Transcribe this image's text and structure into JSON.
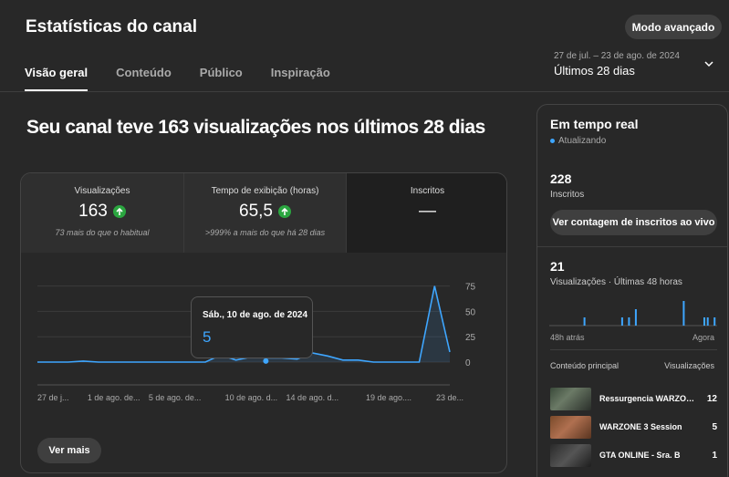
{
  "header": {
    "title": "Estatísticas do canal",
    "advanced_label": "Modo avançado",
    "tabs": [
      {
        "label": "Visão geral",
        "active": true
      },
      {
        "label": "Conteúdo",
        "active": false
      },
      {
        "label": "Público",
        "active": false
      },
      {
        "label": "Inspiração",
        "active": false
      }
    ],
    "date_range": {
      "range": "27 de jul. – 23 de ago. de 2024",
      "label": "Últimos 28 dias"
    }
  },
  "main": {
    "headline": "Seu canal teve 163 visualizações nos últimos 28 dias",
    "metrics": [
      {
        "label": "Visualizações",
        "value": "163",
        "trend": "up",
        "note": "73 mais do que o habitual"
      },
      {
        "label": "Tempo de exibição (horas)",
        "value": "65,5",
        "trend": "up",
        "note": ">999% a mais do que há 28 dias"
      },
      {
        "label": "Inscritos",
        "value": "—",
        "trend": "",
        "note": ""
      }
    ],
    "tooltip": {
      "date": "Sáb., 10 de ago. de 2024",
      "value": "5"
    },
    "more_label": "Ver mais"
  },
  "chart_data": {
    "type": "line",
    "x": [
      "27 de jul.",
      "28 de jul.",
      "29 de jul.",
      "30 de jul.",
      "31 de jul.",
      "1 de ago.",
      "2 de ago.",
      "3 de ago.",
      "4 de ago.",
      "5 de ago.",
      "6 de ago.",
      "7 de ago.",
      "8 de ago.",
      "9 de ago.",
      "10 de ago.",
      "11 de ago.",
      "12 de ago.",
      "13 de ago.",
      "14 de ago.",
      "15 de ago.",
      "16 de ago.",
      "17 de ago.",
      "18 de ago.",
      "19 de ago.",
      "20 de ago.",
      "21 de ago.",
      "22 de ago.",
      "23 de ago."
    ],
    "values": [
      0,
      0,
      0,
      1,
      0,
      0,
      0,
      0,
      0,
      0,
      0,
      0,
      7,
      2,
      5,
      4,
      4,
      3,
      9,
      6,
      2,
      2,
      0,
      0,
      0,
      0,
      75,
      10
    ],
    "tick_labels": [
      "27 de j...",
      "1 de ago. de...",
      "5 de ago. de...",
      "10 de ago. d...",
      "14 de ago. d...",
      "19 de ago....",
      "23 de..."
    ],
    "tick_indices": [
      0,
      5,
      9,
      14,
      18,
      23,
      27
    ],
    "y_ticks": [
      0,
      25,
      50,
      75
    ],
    "ylim": [
      0,
      80
    ],
    "line_color": "#3ea6ff",
    "highlight_index": 14
  },
  "realtime": {
    "title": "Em tempo real",
    "status": "Atualizando",
    "subs_value": "228",
    "subs_label": "Inscritos",
    "live_button": "Ver contagem de inscritos ao vivo",
    "views_value": "21",
    "views_label": "Visualizações · Últimas 48 horas",
    "bars": [
      0,
      0,
      0,
      0,
      0,
      0,
      0,
      0,
      0,
      0,
      1,
      0,
      0,
      0,
      0,
      0,
      0,
      0,
      0,
      0,
      0,
      1,
      0,
      1,
      0,
      2,
      0,
      0,
      0,
      0,
      0,
      0,
      0,
      0,
      0,
      0,
      0,
      0,
      0,
      3,
      0,
      0,
      0,
      0,
      0,
      1,
      1,
      0,
      1
    ],
    "time_left": "48h atrás",
    "time_right": "Agora",
    "col_left": "Conteúdo principal",
    "col_right": "Visualizações",
    "rows": [
      {
        "title": "Ressurgencia WARZONE 3",
        "value": "12"
      },
      {
        "title": "WARZONE 3 Session",
        "value": "5"
      },
      {
        "title": "GTA ONLINE - Sra. B",
        "value": "1"
      }
    ]
  }
}
